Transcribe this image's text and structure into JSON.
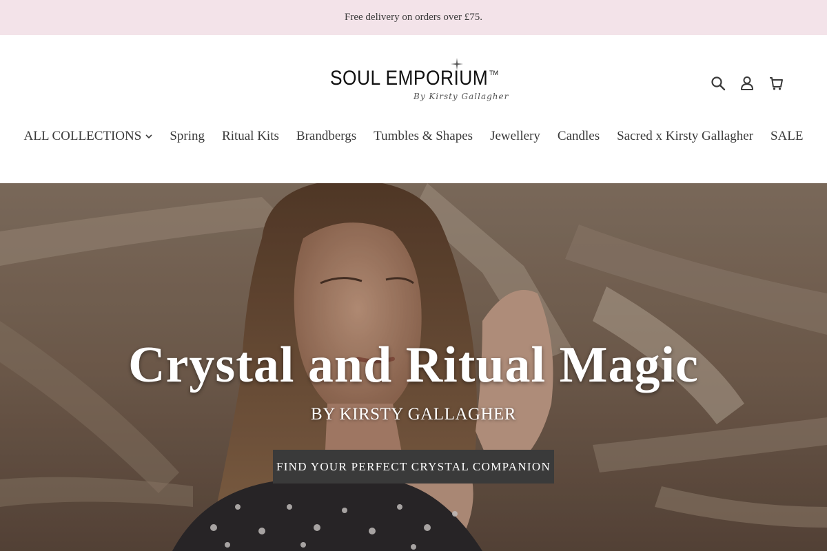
{
  "announcement": {
    "text": "Free delivery on orders over £75."
  },
  "logo": {
    "brand": "SOUL EMPORIUM",
    "tm": "TM",
    "sub": "By Kirsty Gallagher"
  },
  "header_icons": [
    "search-icon",
    "account-icon",
    "cart-icon"
  ],
  "nav": {
    "items": [
      {
        "label": "ALL COLLECTIONS"
      },
      {
        "label": "Spring"
      },
      {
        "label": "Ritual Kits"
      },
      {
        "label": "Brandbergs"
      },
      {
        "label": "Tumbles & Shapes"
      },
      {
        "label": "Jewellery"
      },
      {
        "label": "Candles"
      },
      {
        "label": "Sacred x Kirsty Gallagher"
      },
      {
        "label": "SALE"
      }
    ]
  },
  "hero": {
    "title": "Crystal and Ritual Magic",
    "subtitle": "BY KIRSTY GALLAGHER",
    "cta": "FIND YOUR PERFECT CRYSTAL COMPANION"
  },
  "colors": {
    "announcement_bg": "#f3e3e9",
    "cta_bg": "#3a3a3a",
    "text": "#3a3a3a"
  }
}
